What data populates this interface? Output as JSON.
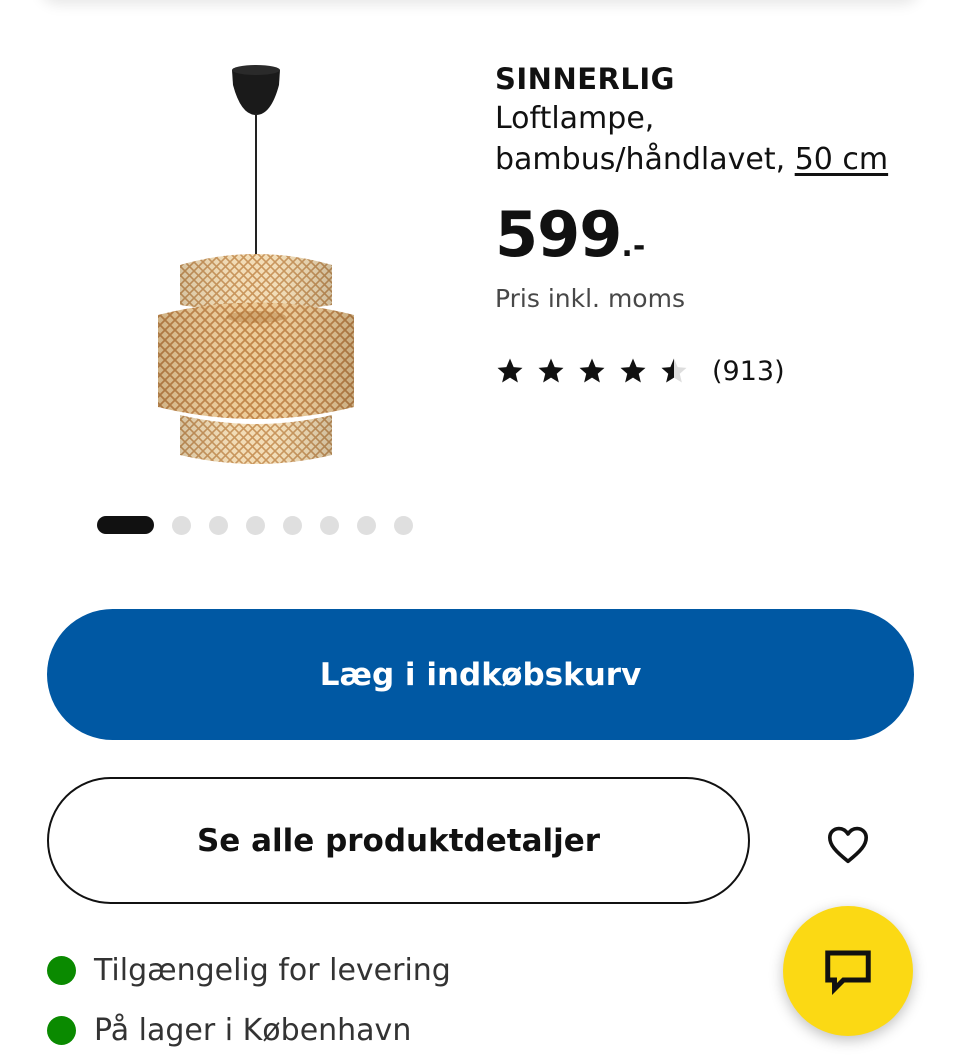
{
  "product": {
    "name": "SINNERLIG",
    "description_line1": "Loftlampe,",
    "description_line2": "bambus/håndlavet,",
    "size_link": "50 cm",
    "price": "599",
    "price_suffix": ".-",
    "price_note": "Pris inkl. moms",
    "rating": {
      "stars": 4.5,
      "max_stars": 5,
      "review_count": "(913)"
    },
    "image_icon": "bamboo-pendant-lamp-image"
  },
  "carousel": {
    "total_images": 8,
    "active_index": 0
  },
  "actions": {
    "add_to_cart_label": "Læg i indkøbskurv",
    "details_label": "Se alle produktdetaljer",
    "favourite_icon": "heart-icon",
    "chat_icon": "chat-icon"
  },
  "availability": [
    {
      "text": "Tilgængelig for levering",
      "status": "available"
    },
    {
      "text": "På lager i København",
      "status": "in-stock"
    }
  ],
  "colors": {
    "primary_blue": "#0058a3",
    "chat_yellow": "#fbd914",
    "status_green": "#0a8a00",
    "text_dark": "#111111"
  }
}
